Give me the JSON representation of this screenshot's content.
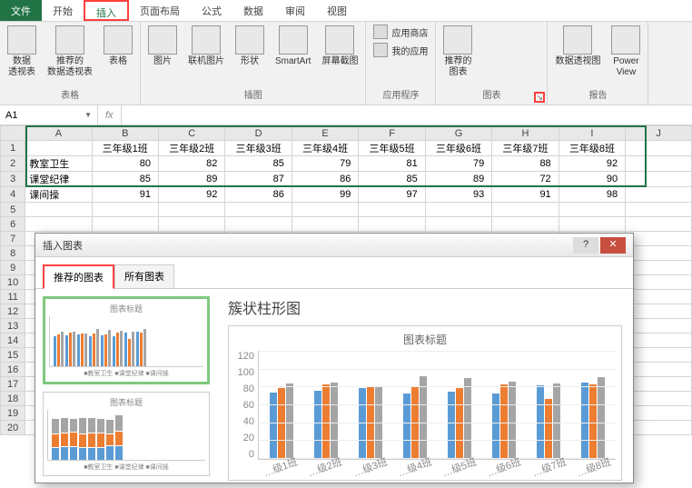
{
  "tabs": {
    "file": "文件",
    "home": "开始",
    "insert": "插入",
    "layout": "页面布局",
    "formula": "公式",
    "data": "数据",
    "review": "审阅",
    "view": "视图"
  },
  "ribbon": {
    "pivot": "数据\n透视表",
    "rec_pivot": "推荐的\n数据透视表",
    "table": "表格",
    "grp_table": "表格",
    "pic": "图片",
    "online_pic": "联机图片",
    "shapes": "形状",
    "smartart": "SmartArt",
    "screenshot": "屏幕截图",
    "grp_illus": "插图",
    "store": "应用商店",
    "myapps": "我的应用",
    "grp_apps": "应用程序",
    "rec_chart": "推荐的\n图表",
    "grp_chart": "图表",
    "pivot_chart": "数据透视图",
    "powerview": "Power\nView",
    "grp_report": "报告"
  },
  "namebox": "A1",
  "sheet": {
    "cols": [
      "A",
      "B",
      "C",
      "D",
      "E",
      "F",
      "G",
      "H",
      "I",
      "J"
    ],
    "headers": [
      "",
      "三年级1班",
      "三年级2班",
      "三年级3班",
      "三年级4班",
      "三年级5班",
      "三年级6班",
      "三年级7班",
      "三年级8班"
    ],
    "rows": [
      {
        "label": "教室卫生",
        "vals": [
          80,
          82,
          85,
          79,
          81,
          79,
          88,
          92
        ]
      },
      {
        "label": "课堂纪律",
        "vals": [
          85,
          89,
          87,
          86,
          85,
          89,
          72,
          90
        ]
      },
      {
        "label": "课间操",
        "vals": [
          91,
          92,
          86,
          99,
          97,
          93,
          91,
          98
        ]
      }
    ]
  },
  "dialog": {
    "title": "插入图表",
    "tab_rec": "推荐的图表",
    "tab_all": "所有图表",
    "thumb_title": "图表标题",
    "thumb_legend": "■教室卫生 ■课堂纪律 ■课间操",
    "chart_type": "簇状柱形图",
    "preview_title": "图表标题",
    "yticks": [
      "120",
      "100",
      "80",
      "60",
      "40",
      "20",
      "0"
    ],
    "xlabels": [
      "…级1班",
      "…级2班",
      "…级3班",
      "…级4班",
      "…级5班",
      "…级6班",
      "…级7班",
      "…级8班"
    ]
  },
  "chart_data": {
    "type": "bar",
    "title": "图表标题",
    "categories": [
      "三年级1班",
      "三年级2班",
      "三年级3班",
      "三年级4班",
      "三年级5班",
      "三年级6班",
      "三年级7班",
      "三年级8班"
    ],
    "series": [
      {
        "name": "教室卫生",
        "values": [
          80,
          82,
          85,
          79,
          81,
          79,
          88,
          92
        ]
      },
      {
        "name": "课堂纪律",
        "values": [
          85,
          89,
          87,
          86,
          85,
          89,
          72,
          90
        ]
      },
      {
        "name": "课间操",
        "values": [
          91,
          92,
          86,
          99,
          97,
          93,
          91,
          98
        ]
      }
    ],
    "ylim": [
      0,
      120
    ],
    "ylabel": "",
    "xlabel": ""
  }
}
